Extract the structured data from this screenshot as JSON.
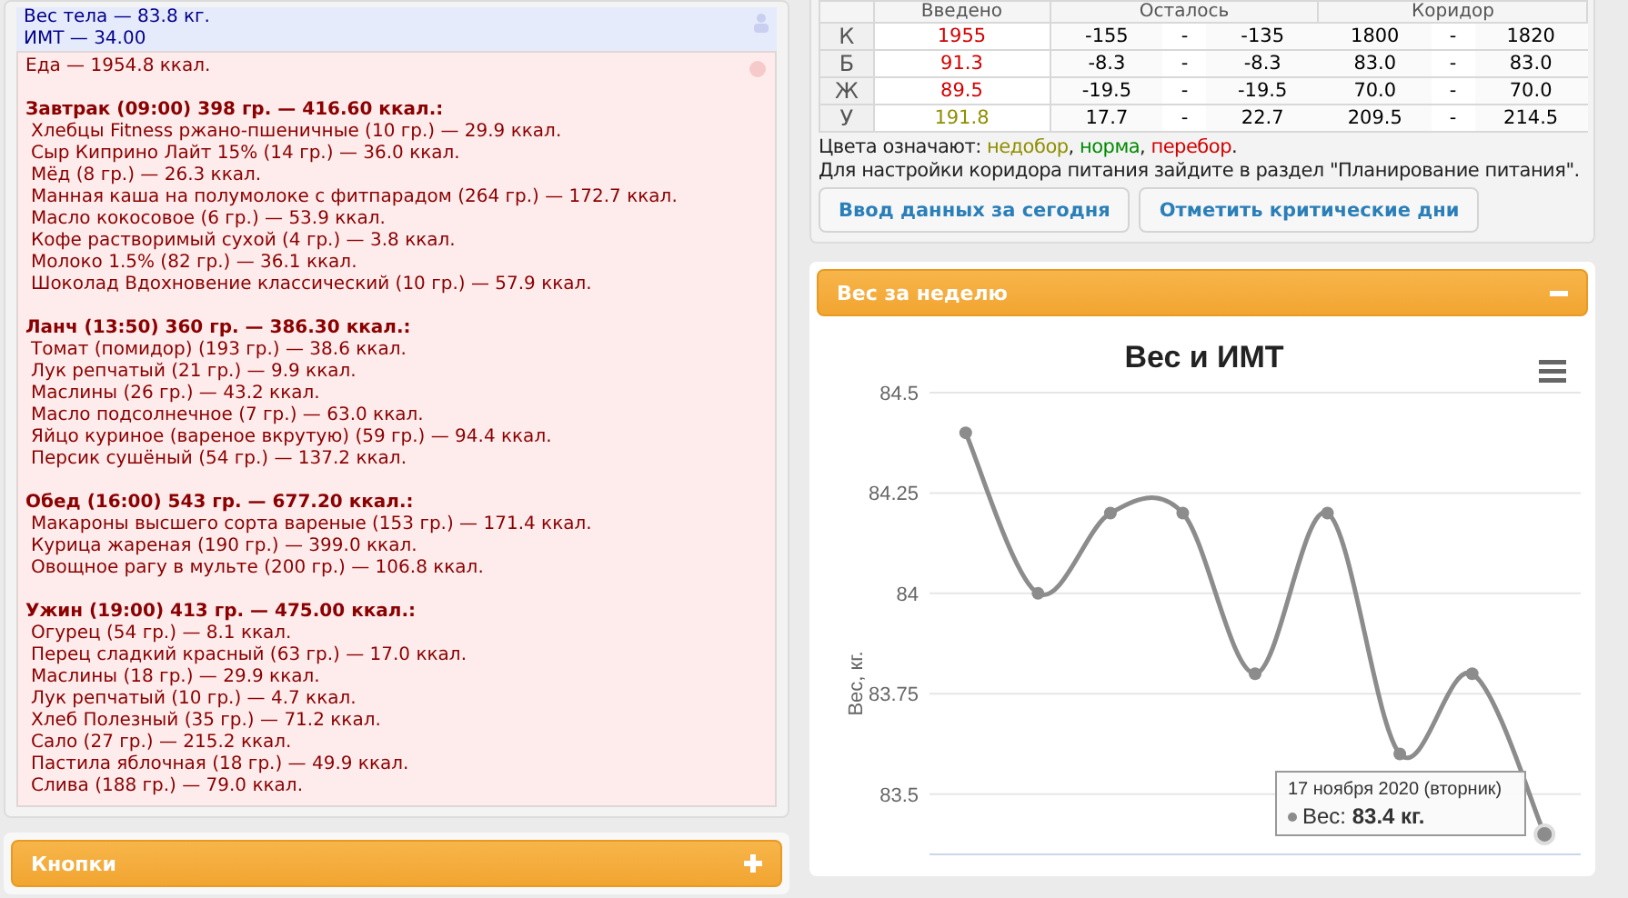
{
  "body_summary": {
    "lines": [
      "Вес тела — 83.8 кг.",
      "ИМТ — 34.00"
    ]
  },
  "food_log": {
    "total": "Еда — 1954.8 ккал.",
    "meals": [
      {
        "title": "Завтрак (09:00) 398 гр. — 416.60 ккал.:",
        "items": [
          "Хлебцы Fitness ржано-пшеничные (10 гр.) — 29.9 ккал.",
          "Сыр Киприно Лайт 15% (14 гр.) — 36.0 ккал.",
          "Мёд (8 гр.) — 26.3 ккал.",
          "Манная каша на полумолоке с фитпарадом (264 гр.) — 172.7 ккал.",
          "Масло кокосовое (6 гр.) — 53.9 ккал.",
          "Кофе растворимый сухой (4 гр.) — 3.8 ккал.",
          "Молоко 1.5% (82 гр.) — 36.1 ккал.",
          "Шоколад Вдохновение классический (10 гр.) — 57.9 ккал."
        ]
      },
      {
        "title": "Ланч (13:50) 360 гр. — 386.30 ккал.:",
        "items": [
          "Томат (помидор) (193 гр.) — 38.6 ккал.",
          "Лук репчатый (21 гр.) — 9.9 ккал.",
          "Маслины (26 гр.) — 43.2 ккал.",
          "Масло подсолнечное (7 гр.) — 63.0 ккал.",
          "Яйцо куриное (вареное вкрутую) (59 гр.) — 94.4 ккал.",
          "Персик сушёный (54 гр.) — 137.2 ккал."
        ]
      },
      {
        "title": "Обед (16:00) 543 гр. — 677.20 ккал.:",
        "items": [
          "Макароны высшего сорта вареные (153 гр.) — 171.4 ккал.",
          "Курица жареная (190 гр.) — 399.0 ккал.",
          "Овощное рагу в мульте (200 гр.) — 106.8 ккал."
        ]
      },
      {
        "title": "Ужин (19:00) 413 гр. — 475.00 ккал.:",
        "items": [
          "Огурец (54 гр.) — 8.1 ккал.",
          "Перец сладкий красный (63 гр.) — 17.0 ккал.",
          "Маслины (18 гр.) — 29.9 ккал.",
          "Лук репчатый (10 гр.) — 4.7 ккал.",
          "Хлеб Полезный (35 гр.) — 71.2 ккал.",
          "Сало (27 гр.) — 215.2 ккал.",
          "Пастила яблочная (18 гр.) — 49.9 ккал.",
          "Слива (188 гр.) — 79.0 ккал."
        ]
      }
    ]
  },
  "buttons_panel": {
    "title": "Кнопки",
    "expanded": false
  },
  "nutrition_table": {
    "columns": [
      "Введено",
      "Осталось",
      "Коридор"
    ],
    "rows": [
      {
        "label": "К",
        "entered": "1955",
        "color": "#d40000",
        "remaining": [
          "-155",
          "-",
          "-135"
        ],
        "corridor": [
          "1800",
          "-",
          "1820"
        ]
      },
      {
        "label": "Б",
        "entered": "91.3",
        "color": "#d40000",
        "remaining": [
          "-8.3",
          "-",
          "-8.3"
        ],
        "corridor": [
          "83.0",
          "-",
          "83.0"
        ]
      },
      {
        "label": "Ж",
        "entered": "89.5",
        "color": "#d40000",
        "remaining": [
          "-19.5",
          "-",
          "-19.5"
        ],
        "corridor": [
          "70.0",
          "-",
          "70.0"
        ]
      },
      {
        "label": "У",
        "entered": "191.8",
        "color": "#8f8f00",
        "remaining": [
          "17.7",
          "-",
          "22.7"
        ],
        "corridor": [
          "209.5",
          "-",
          "214.5"
        ]
      }
    ]
  },
  "legend": {
    "lead": "Цвета означают:",
    "items": [
      {
        "label": "недобор",
        "color": "#8f8f00",
        "suffix": ","
      },
      {
        "label": "норма",
        "color": "#008a00",
        "suffix": ","
      },
      {
        "label": "перебор",
        "color": "#d40000",
        "suffix": "."
      }
    ]
  },
  "hint": "Для настройки коридора питания зайдите в раздел \"Планирование питания\".",
  "actions": [
    "Ввод данных за сегодня",
    "Отметить критические дни"
  ],
  "weight_panel": {
    "title": "Вес за неделю",
    "expanded": true,
    "chart_data": {
      "type": "line",
      "title": "Вес и ИМТ",
      "ylabel": "Вес, кг.",
      "categories": [
        null,
        null,
        null,
        null,
        null,
        null,
        null,
        null,
        null
      ],
      "ylim": [
        83.35,
        84.5
      ],
      "grid": true,
      "yticks": [
        83.5,
        83.75,
        84,
        84.25,
        84.5
      ],
      "series": [
        {
          "color": "#8c8c8c",
          "marker": "circle",
          "values": [
            84.4,
            84.0,
            84.2,
            84.2,
            83.8,
            84.2,
            83.6,
            83.8,
            83.4
          ]
        }
      ]
    },
    "tooltip": {
      "date": "17 ноября 2020 (вторник)",
      "text": "Вес: **83.4 кг.**"
    }
  }
}
